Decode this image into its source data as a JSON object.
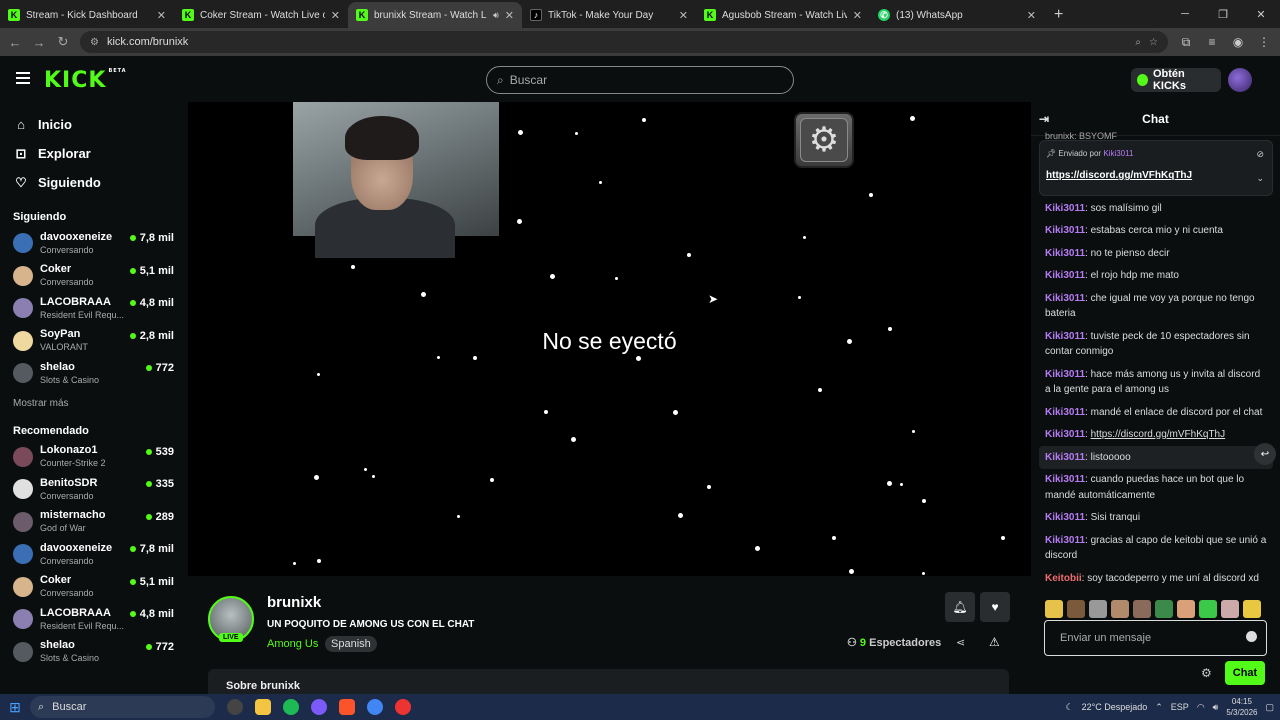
{
  "browser": {
    "tabs": [
      {
        "label": "Stream - Kick Dashboard",
        "icon": "kick-icon"
      },
      {
        "label": "Coker Stream - Watch Live on K",
        "icon": "kick-icon"
      },
      {
        "label": "brunixk Stream - Watch Live",
        "icon": "kick-icon",
        "active": true
      },
      {
        "label": "TikTok - Make Your Day",
        "icon": "tiktok-icon"
      },
      {
        "label": "Agusbob Stream - Watch Live o",
        "icon": "kick-icon"
      },
      {
        "label": "(13) WhatsApp",
        "icon": "whatsapp-icon"
      }
    ],
    "url": "kick.com/brunixk"
  },
  "header": {
    "logo": "KICK",
    "logo_sup": "BETA",
    "search_placeholder": "Buscar",
    "kicks_button": "Obtén KICKs"
  },
  "sidebar": {
    "nav": [
      {
        "label": "Inicio",
        "icon": "home-icon"
      },
      {
        "label": "Explorar",
        "icon": "compass-icon"
      },
      {
        "label": "Siguiendo",
        "icon": "heart-icon"
      }
    ],
    "following_title": "Siguiendo",
    "following": [
      {
        "name": "davooxeneize",
        "game": "Conversando",
        "viewers": "7,8 mil",
        "color": "#3a6fb5"
      },
      {
        "name": "Coker",
        "game": "Conversando",
        "viewers": "5,1 mil",
        "color": "#d7b48c"
      },
      {
        "name": "LACOBRAAA",
        "game": "Resident Evil Requ...",
        "viewers": "4,8 mil",
        "color": "#8a7fb0"
      },
      {
        "name": "SoyPan",
        "game": "VALORANT",
        "viewers": "2,8 mil",
        "color": "#f0d9a0"
      },
      {
        "name": "shelao",
        "game": "Slots & Casino",
        "viewers": "772",
        "color": "#555a60"
      }
    ],
    "show_more": "Mostrar más",
    "recommended_title": "Recomendado",
    "recommended": [
      {
        "name": "Lokonazo1",
        "game": "Counter-Strike 2",
        "viewers": "539",
        "color": "#7a4a5a"
      },
      {
        "name": "BenitoSDR",
        "game": "Conversando",
        "viewers": "335",
        "color": "#e0e0e0"
      },
      {
        "name": "misternacho",
        "game": "God of War",
        "viewers": "289",
        "color": "#6b5b6b"
      },
      {
        "name": "davooxeneize",
        "game": "Conversando",
        "viewers": "7,8 mil",
        "color": "#3a6fb5"
      },
      {
        "name": "Coker",
        "game": "Conversando",
        "viewers": "5,1 mil",
        "color": "#d7b48c"
      },
      {
        "name": "LACOBRAAA",
        "game": "Resident Evil Requ...",
        "viewers": "4,8 mil",
        "color": "#8a7fb0"
      },
      {
        "name": "shelao",
        "game": "Slots & Casino",
        "viewers": "772",
        "color": "#555a60"
      }
    ]
  },
  "player": {
    "caption": "No se eyectó"
  },
  "stream": {
    "streamer": "brunixk",
    "live_badge": "LIVE",
    "title": "UN  POQUITO DE AMONG US CON EL CHAT",
    "category": "Among Us",
    "tag": "Spanish",
    "viewers_count": "9",
    "viewers_label": "Espectadores",
    "about": "Sobre brunixk"
  },
  "chat": {
    "title": "Chat",
    "top_message": "brunixk: BSYOMF",
    "pinned_by_label": "Enviado por",
    "pinned_by_user": "Kiki3011",
    "pinned_link": "https://discord.gg/mVFhKqThJ",
    "messages": [
      {
        "user": "Kiki3011",
        "text": "sos malísimo gil"
      },
      {
        "user": "Kiki3011",
        "text": "estabas cerca mio y ni cuenta"
      },
      {
        "user": "Kiki3011",
        "text": "no te pienso decir"
      },
      {
        "user": "Kiki3011",
        "text": "el rojo hdp me mato"
      },
      {
        "user": "Kiki3011",
        "text": "che igual me voy ya porque no tengo bateria"
      },
      {
        "user": "Kiki3011",
        "text": "tuviste peck de 10 espectadores sin contar conmigo"
      },
      {
        "user": "Kiki3011",
        "text": "hace más among us y invita al discord a la gente para el among us"
      },
      {
        "user": "Kiki3011",
        "text": "mandé el enlace de discord por el chat"
      },
      {
        "user": "Kiki3011",
        "text": "https://discord.gg/mVFhKqThJ",
        "link": true
      },
      {
        "user": "Kiki3011",
        "text": "listooooo",
        "highlight": true
      },
      {
        "user": "Kiki3011",
        "text": "cuando puedas hace un bot que lo mandé automáticamente"
      },
      {
        "user": "Kiki3011",
        "text": "Sisi tranqui"
      },
      {
        "user": "Kiki3011",
        "text": "gracias al capo de keitobi que se unió a discord"
      },
      {
        "user": "Keitobii",
        "text": "soy tacodeperro y me uní al discord xd",
        "alt": true
      }
    ],
    "input_placeholder": "Enviar un mensaje",
    "send_button": "Chat"
  },
  "taskbar": {
    "search": "Buscar",
    "weather": "22°C  Despejado",
    "lang": "ESP",
    "time": "04:15",
    "date": "5/3/2026"
  },
  "colors": {
    "accent": "#53fc18",
    "chat_user": "#b57cf3"
  }
}
